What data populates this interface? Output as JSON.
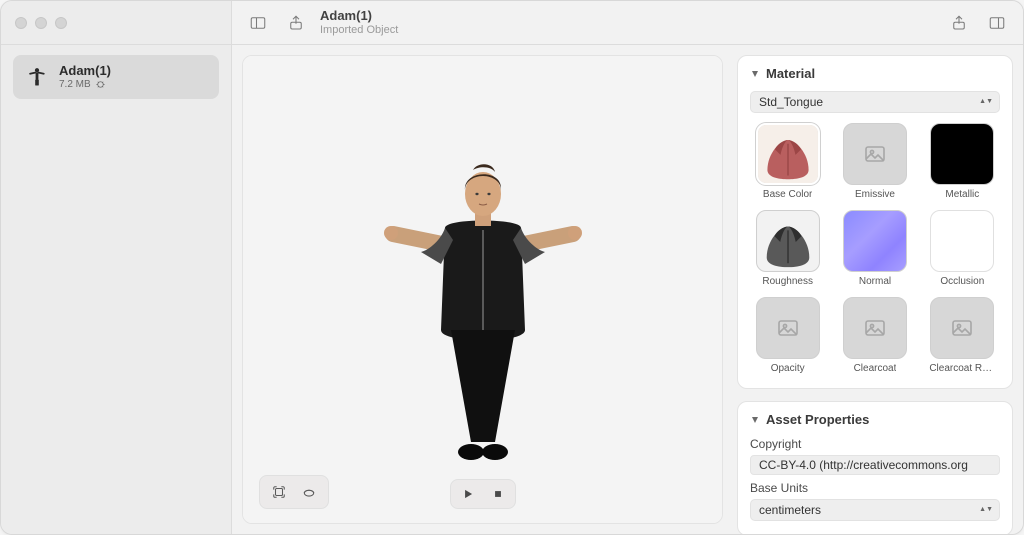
{
  "header": {
    "title": "Adam(1)",
    "subtitle": "Imported Object"
  },
  "sidebar": {
    "items": [
      {
        "title": "Adam(1)",
        "size": "7.2 MB"
      }
    ]
  },
  "inspector": {
    "material": {
      "title": "Material",
      "selected": "Std_Tongue",
      "slots": [
        {
          "label": "Base Color",
          "kind": "tongue-color"
        },
        {
          "label": "Emissive",
          "kind": "placeholder"
        },
        {
          "label": "Metallic",
          "kind": "black"
        },
        {
          "label": "Roughness",
          "kind": "tongue-rough"
        },
        {
          "label": "Normal",
          "kind": "normal"
        },
        {
          "label": "Occlusion",
          "kind": "white"
        },
        {
          "label": "Opacity",
          "kind": "placeholder"
        },
        {
          "label": "Clearcoat",
          "kind": "placeholder"
        },
        {
          "label": "Clearcoat Ro…",
          "kind": "placeholder"
        }
      ]
    },
    "assetProperties": {
      "title": "Asset Properties",
      "copyright_label": "Copyright",
      "copyright_value": "CC-BY-4.0 (http://creativecommons.org",
      "base_units_label": "Base Units",
      "base_units_value": "centimeters"
    }
  }
}
